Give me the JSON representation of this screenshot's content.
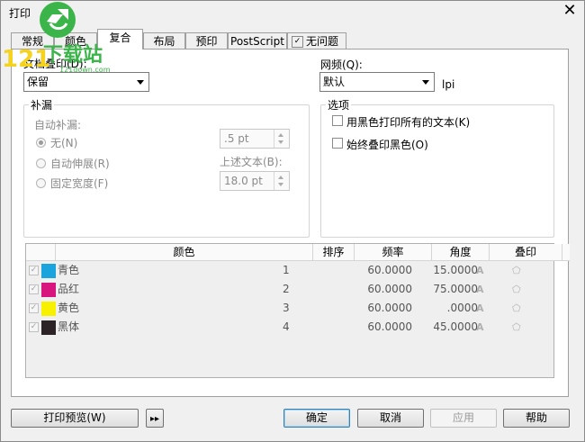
{
  "window": {
    "title": "打印"
  },
  "tabs": [
    "常规",
    "颜色",
    "复合",
    "布局",
    "预印",
    "PostScript",
    "无问题"
  ],
  "watermark": {
    "text": "121下载站",
    "url": "121down.com"
  },
  "left": {
    "overprint_label": "文档叠印(D):",
    "overprint_value": "保留",
    "trap_group": "补漏",
    "auto_trap": "自动补漏:",
    "radio_none": "无(N)",
    "radio_auto": "自动伸展(R)",
    "radio_fixed": "固定宽度(F)",
    "spin1": ".5 pt",
    "above_text": "上述文本(B):",
    "spin2": "18.0 pt"
  },
  "right": {
    "screen_label": "网频(Q):",
    "screen_value": "默认",
    "lpi": "lpi",
    "options_group": "选项",
    "opt1": "用黑色打印所有的文本(K)",
    "opt2": "始终叠印黑色(O)"
  },
  "table": {
    "headers": [
      "颜色",
      "排序",
      "频率",
      "角度",
      "叠印"
    ],
    "rows": [
      {
        "name": "青色",
        "color": "#1aa3dc",
        "order": "1",
        "freq": "60.0000",
        "angle": "15.0000"
      },
      {
        "name": "品红",
        "color": "#d8157f",
        "order": "2",
        "freq": "60.0000",
        "angle": "75.0000"
      },
      {
        "name": "黄色",
        "color": "#f7f100",
        "order": "3",
        "freq": "60.0000",
        "angle": ".0000"
      },
      {
        "name": "黑体",
        "color": "#2b2325",
        "order": "4",
        "freq": "60.0000",
        "angle": "45.0000"
      }
    ]
  },
  "buttons": {
    "preview": "打印预览(W)",
    "ok": "确定",
    "cancel": "取消",
    "apply": "应用",
    "help": "帮助"
  }
}
